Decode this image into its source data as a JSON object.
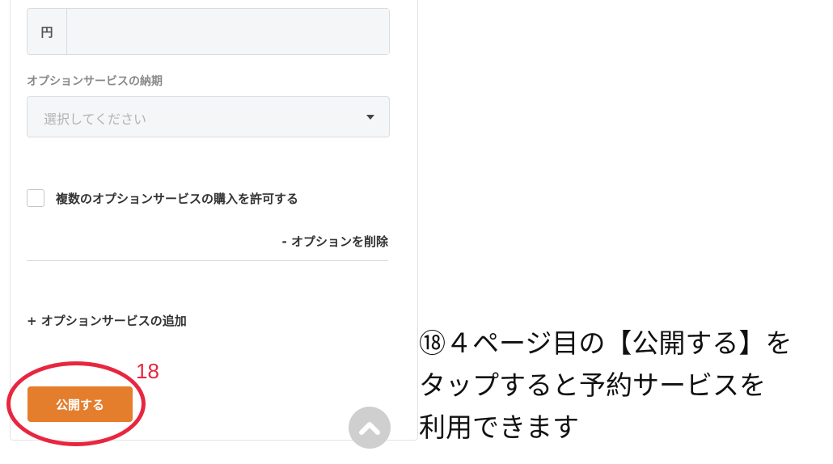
{
  "form": {
    "currency_addon": "円",
    "delivery_label": "オプションサービスの納期",
    "delivery_placeholder": "選択してください",
    "allow_multiple_label": "複数のオプションサービスの購入を許可する",
    "allow_multiple_checked": false,
    "remove_option_label": "- オプションを削除",
    "add_option_label": "+ オプションサービスの追加",
    "publish_label": "公開する"
  },
  "annotation": {
    "step_number": "18",
    "highlight_color": "#e8263f",
    "caption_lines": [
      "⑱４ページ目の【公開する】を",
      "タップすると予約サービスを",
      "利用できます"
    ]
  },
  "colors": {
    "publish_button": "#e47d2c",
    "scroll_top_button": "#cfcfcf"
  },
  "icons": {
    "select_caret": "caret-down-icon",
    "scroll_top": "chevron-up-icon"
  }
}
